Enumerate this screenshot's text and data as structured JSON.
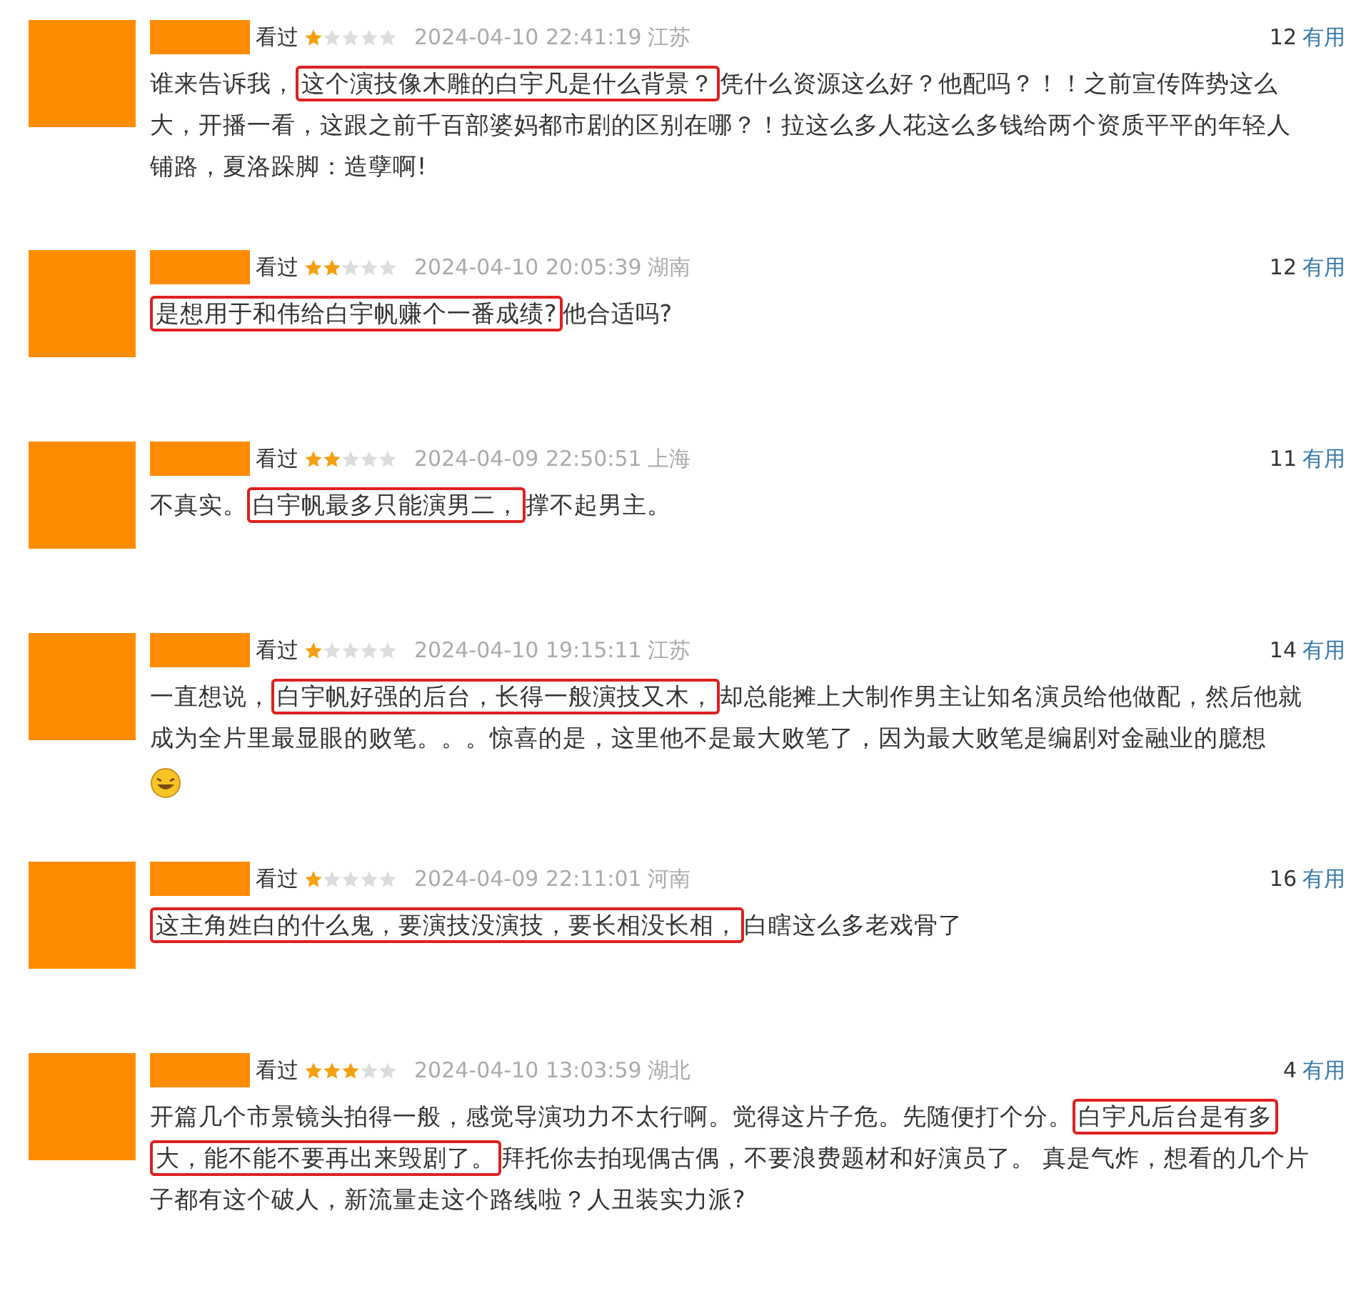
{
  "reviews": [
    {
      "status": "看过",
      "stars": 1,
      "time": "2024-04-10 22:41:19",
      "location": "江苏",
      "votes": "12",
      "useful": "有用",
      "has_emoji": false,
      "segments": [
        {
          "text": "谁来告诉我，",
          "highlighted": false
        },
        {
          "text": "这个演技像木雕的白宇凡是什么背景？",
          "highlighted": true
        },
        {
          "text": "凭什么资源这么好？他配吗？！！之前宣传阵势这么大，开播一看，这跟之前千百部婆妈都市剧的区别在哪？！拉这么多人花这么多钱给两个资质平平的年轻人铺路，夏洛跺脚：造孽啊!",
          "highlighted": false
        }
      ]
    },
    {
      "status": "看过",
      "stars": 2,
      "time": "2024-04-10 20:05:39",
      "location": "湖南",
      "votes": "12",
      "useful": "有用",
      "has_emoji": false,
      "segments": [
        {
          "text": "是想用于和伟给白宇帆赚个一番成绩?",
          "highlighted": true
        },
        {
          "text": "他合适吗?",
          "highlighted": false
        }
      ]
    },
    {
      "status": "看过",
      "stars": 2,
      "time": "2024-04-09 22:50:51",
      "location": "上海",
      "votes": "11",
      "useful": "有用",
      "has_emoji": false,
      "segments": [
        {
          "text": "不真实。",
          "highlighted": false
        },
        {
          "text": "白宇帆最多只能演男二，",
          "highlighted": true
        },
        {
          "text": "撑不起男主。",
          "highlighted": false
        }
      ]
    },
    {
      "status": "看过",
      "stars": 1,
      "time": "2024-04-10 19:15:11",
      "location": "江苏",
      "votes": "14",
      "useful": "有用",
      "has_emoji": true,
      "segments": [
        {
          "text": "一直想说，",
          "highlighted": false
        },
        {
          "text": "白宇帆好强的后台，长得一般演技又木，",
          "highlighted": true
        },
        {
          "text": "却总能摊上大制作男主让知名演员给他做配，然后他就成为全片里最显眼的败笔。。。惊喜的是，这里他不是最大败笔了，因为最大败笔是编剧对金融业的臆想",
          "highlighted": false
        }
      ]
    },
    {
      "status": "看过",
      "stars": 1,
      "time": "2024-04-09 22:11:01",
      "location": "河南",
      "votes": "16",
      "useful": "有用",
      "has_emoji": false,
      "segments": [
        {
          "text": "这主角姓白的什么鬼，要演技没演技，要长相没长相，",
          "highlighted": true
        },
        {
          "text": "白瞎这么多老戏骨了",
          "highlighted": false
        }
      ]
    },
    {
      "status": "看过",
      "stars": 3,
      "time": "2024-04-10 13:03:59",
      "location": "湖北",
      "votes": "4",
      "useful": "有用",
      "has_emoji": false,
      "segments": [
        {
          "text": "开篇几个市景镜头拍得一般，感觉导演功力不太行啊。觉得这片子危。先随便打个分。",
          "highlighted": false
        },
        {
          "text": "白宇凡后台是有多大，能不能不要再出来毁剧了。",
          "highlighted": true
        },
        {
          "text": "拜托你去拍现偶古偶，不要浪费题材和好演员了。 真是气炸，想看的几个片子都有这个破人，新流量走这个路线啦？人丑装实力派?",
          "highlighted": false
        }
      ]
    }
  ]
}
